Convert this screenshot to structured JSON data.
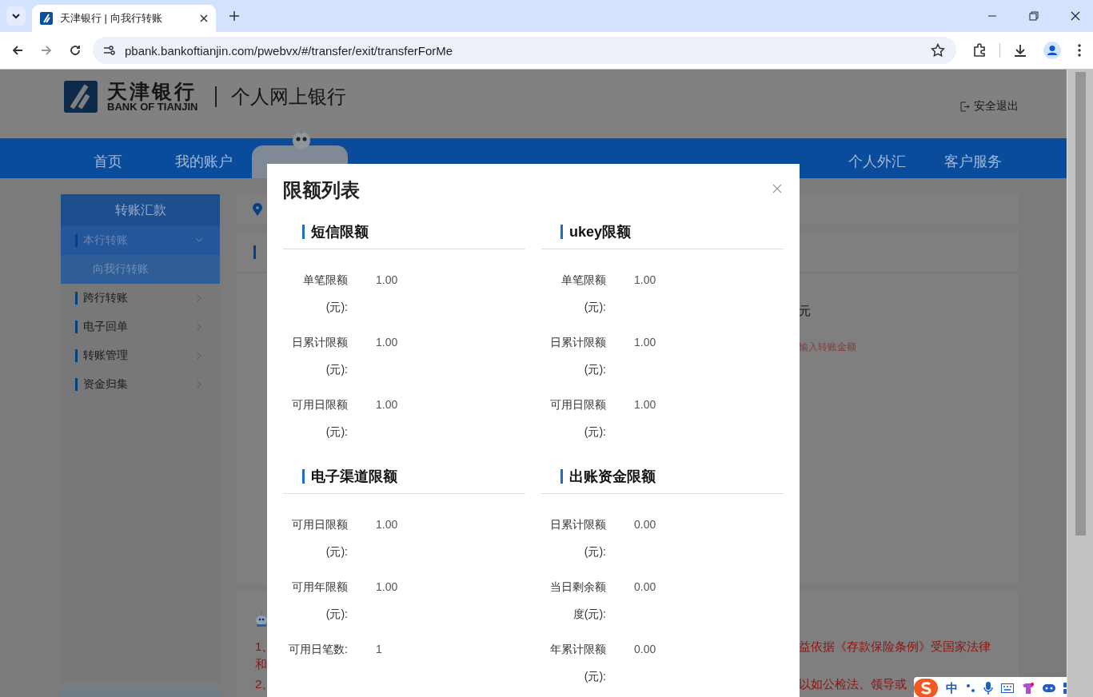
{
  "browser": {
    "tabs": [
      {
        "title": "天津银行 | 向我行转账",
        "selected": true
      }
    ],
    "url": "pbank.bankoftianjin.com/pwebvx/#/transfer/exit/transferForMe"
  },
  "header": {
    "bank_name": "天津银行",
    "bank_name_en": "BANK OF TIANJIN",
    "portal": "个人网上银行",
    "logout": "安全退出"
  },
  "nav": {
    "left": [
      {
        "label": "首页",
        "selected": false
      },
      {
        "label": "我的账户",
        "selected": false
      },
      {
        "selected": true
      }
    ],
    "right": [
      {
        "label": "个人外汇",
        "selected": false
      },
      {
        "label": "客户服务",
        "selected": false
      }
    ]
  },
  "sidebar": {
    "title": "转账汇款",
    "items": [
      {
        "label": "本行转账",
        "expanded": true,
        "children": [
          {
            "label": "向我行转账",
            "selected": true
          }
        ]
      },
      {
        "label": "跨行转账",
        "expanded": false
      },
      {
        "label": "电子回单",
        "expanded": false
      },
      {
        "label": "转账管理",
        "expanded": false
      },
      {
        "label": "资金归集",
        "expanded": false
      }
    ]
  },
  "content": {
    "unit": "元",
    "hint": "输入转账金额",
    "notes": [
      {
        "number": "1、",
        "text": "益依据《存款保险条例》受国家法律",
        "continuation": "和"
      },
      {
        "number": "2、",
        "text": "以如公检法、领导或"
      }
    ]
  },
  "modal": {
    "title": "限额列表",
    "sections": [
      {
        "title": "短信限额",
        "rows": [
          {
            "label": "单笔限额(元):",
            "value": "1.00"
          },
          {
            "label": "日累计限额(元):",
            "value": "1.00"
          },
          {
            "label": "可用日限额(元):",
            "value": "1.00"
          }
        ]
      },
      {
        "title": "ukey限额",
        "rows": [
          {
            "label": "单笔限额(元):",
            "value": "1.00"
          },
          {
            "label": "日累计限额(元):",
            "value": "1.00"
          },
          {
            "label": "可用日限额(元):",
            "value": "1.00"
          }
        ]
      },
      {
        "title": "电子渠道限额",
        "rows": [
          {
            "label": "可用日限额(元):",
            "value": "1.00"
          },
          {
            "label": "可用年限额(元):",
            "value": "1.00"
          },
          {
            "label": "可用日笔数:",
            "value": "1"
          }
        ]
      },
      {
        "title": "出账资金限额",
        "rows": [
          {
            "label": "日累计限额(元):",
            "value": "0.00"
          },
          {
            "label": "当日剩余额度(元):",
            "value": "0.00"
          },
          {
            "label": "年累计限额(元):",
            "value": "0.00"
          }
        ]
      }
    ]
  },
  "ime": {
    "mode": "中"
  }
}
